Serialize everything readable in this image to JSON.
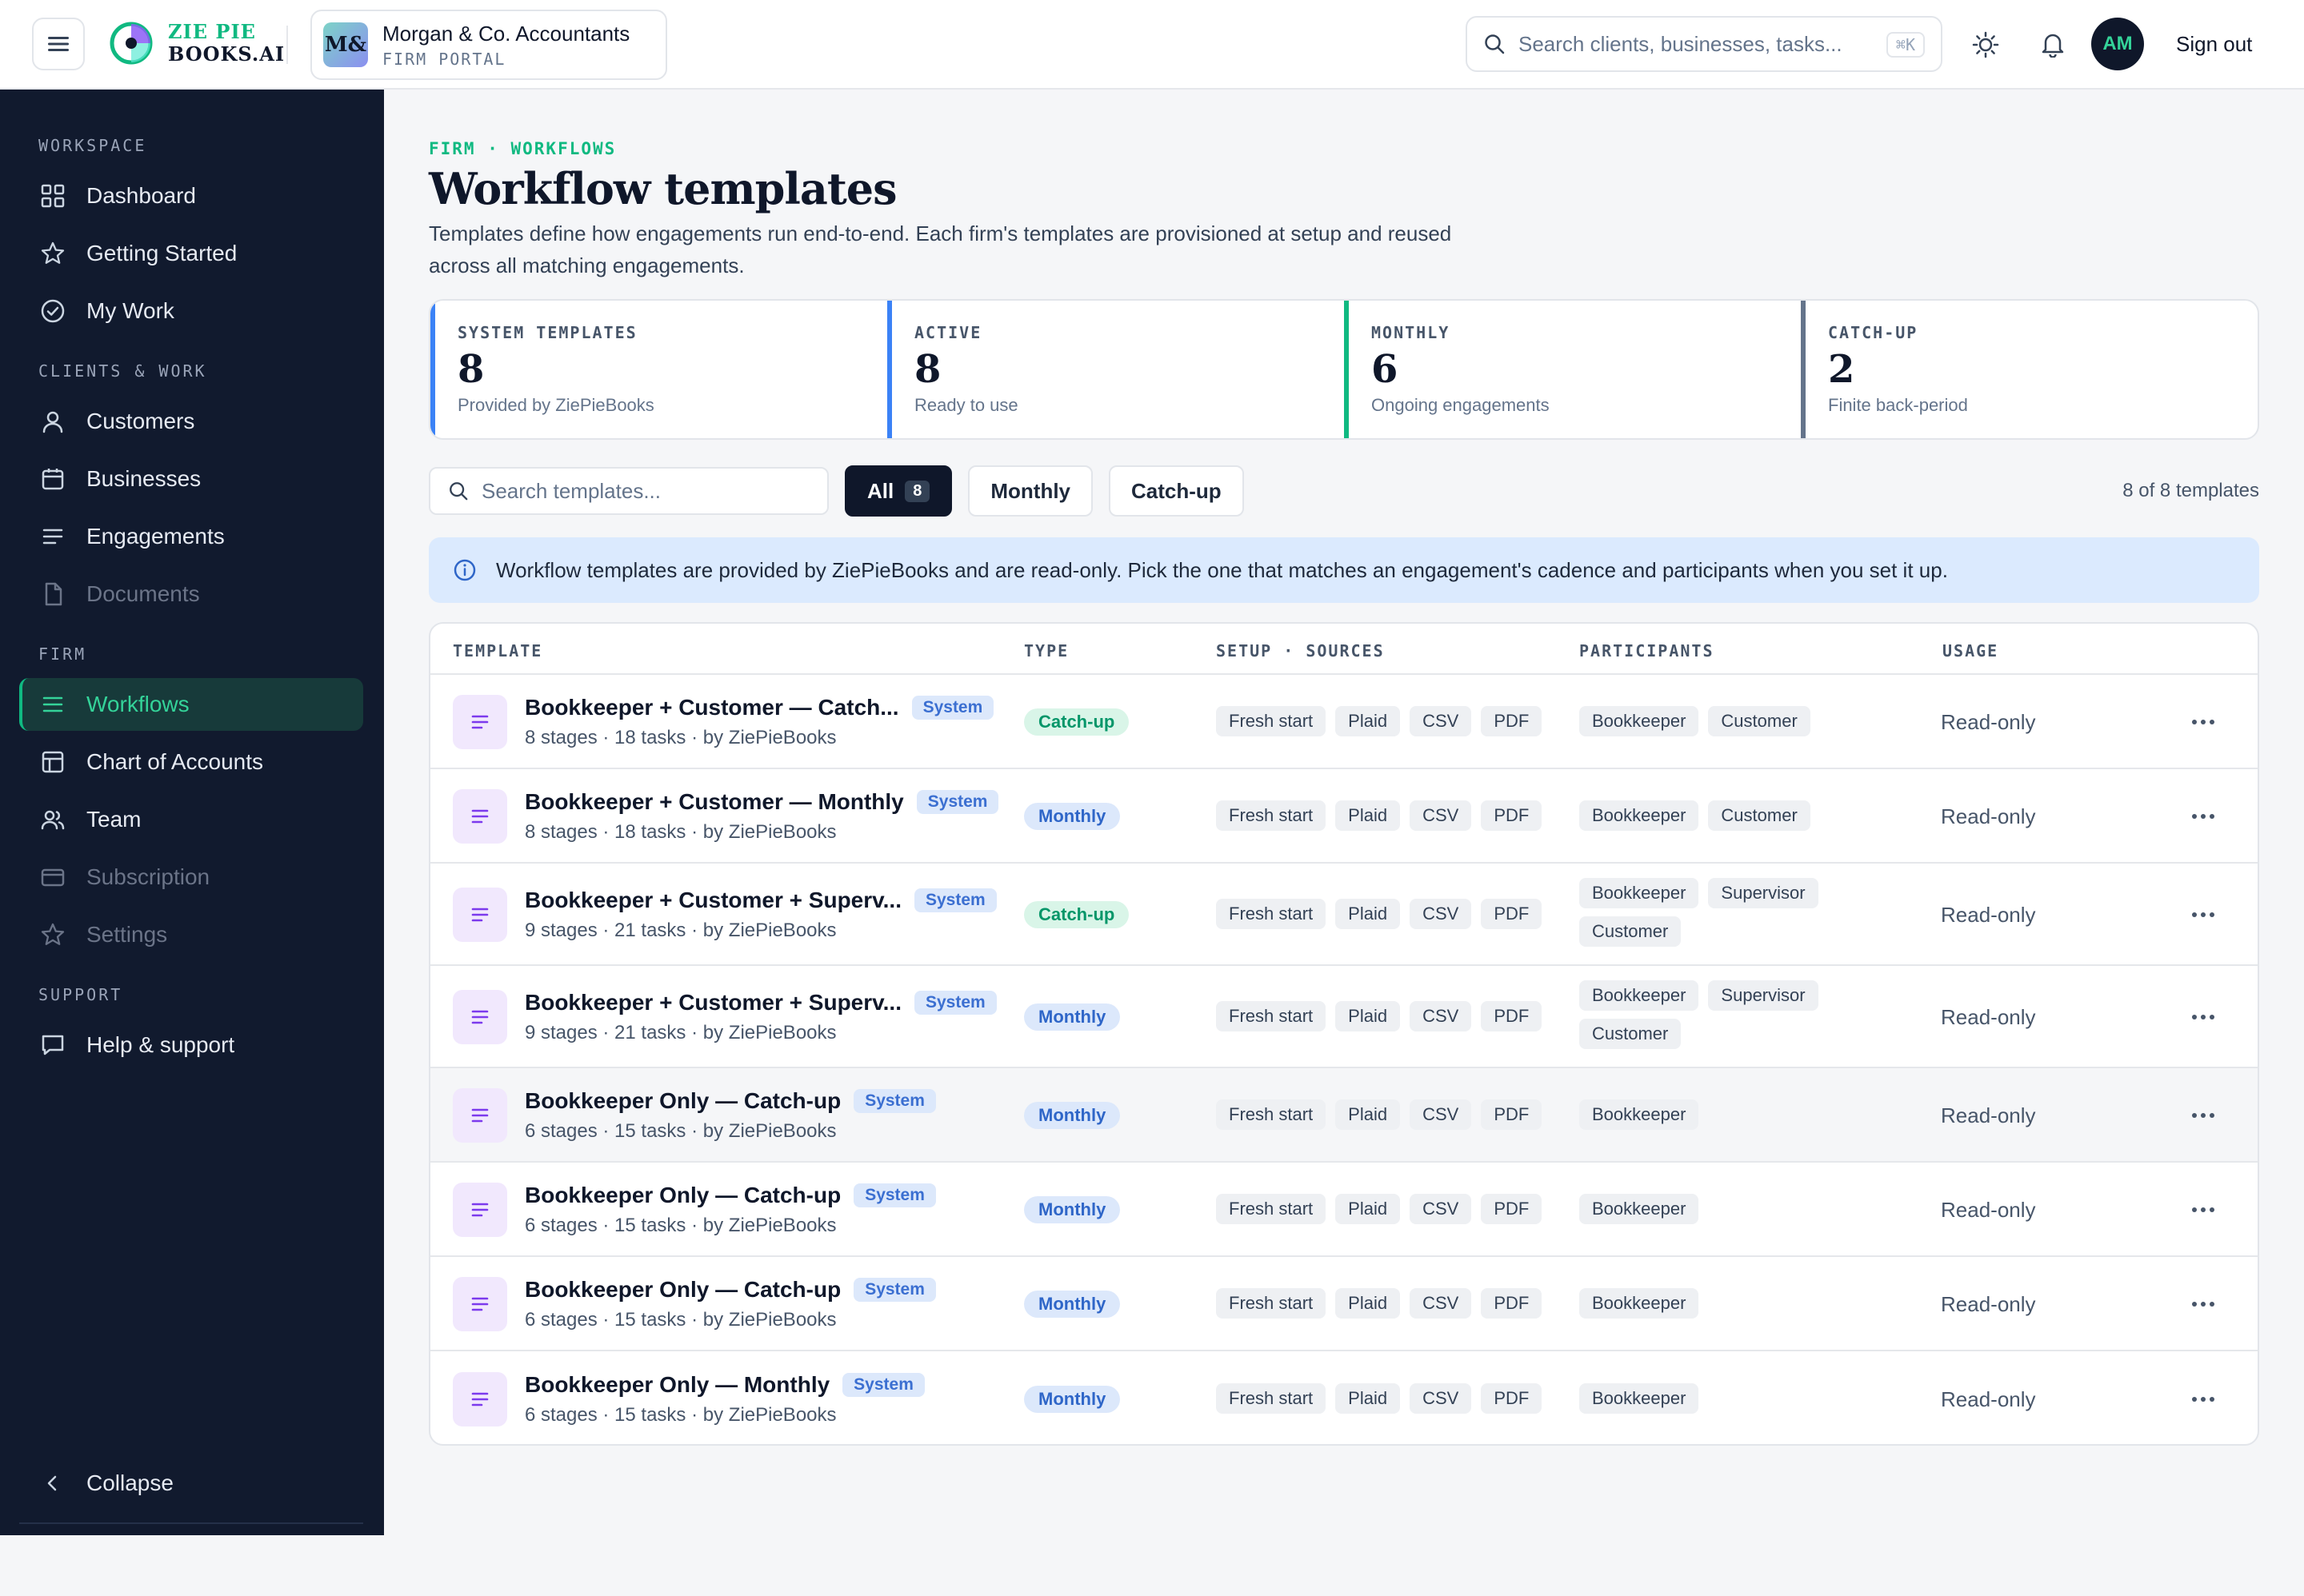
{
  "header": {
    "logo_line1": "ZIE PIE",
    "logo_line2": "BOOKS.AI",
    "firm_initials": "M&",
    "firm_name": "Morgan & Co. Accountants",
    "firm_sub": "FIRM PORTAL",
    "search_placeholder": "Search clients, businesses, tasks...",
    "search_shortcut": "⌘K",
    "user_initials": "AM",
    "sign_out": "Sign out"
  },
  "sidebar": {
    "groups": {
      "workspace": "WORKSPACE",
      "clients": "CLIENTS & WORK",
      "firm": "FIRM",
      "support": "SUPPORT"
    },
    "items": [
      {
        "label": "Dashboard",
        "icon": "grid-icon"
      },
      {
        "label": "Getting Started",
        "icon": "star-icon"
      },
      {
        "label": "My Work",
        "icon": "check-circle-icon"
      },
      {
        "label": "Customers",
        "icon": "user-icon"
      },
      {
        "label": "Businesses",
        "icon": "calendar-icon"
      },
      {
        "label": "Engagements",
        "icon": "lines-icon"
      },
      {
        "label": "Documents",
        "icon": "file-icon"
      },
      {
        "label": "Workflows",
        "icon": "lines-icon"
      },
      {
        "label": "Chart of Accounts",
        "icon": "layout-icon"
      },
      {
        "label": "Team",
        "icon": "users-icon"
      },
      {
        "label": "Subscription",
        "icon": "card-icon"
      },
      {
        "label": "Settings",
        "icon": "star-icon"
      },
      {
        "label": "Help & support",
        "icon": "chat-icon"
      }
    ],
    "collapse": "Collapse"
  },
  "page": {
    "breadcrumb": "FIRM · WORKFLOWS",
    "title": "Workflow templates",
    "description": "Templates define how engagements run end-to-end. Each firm's templates are provisioned at setup and reused across all matching engagements."
  },
  "stats": [
    {
      "label": "SYSTEM TEMPLATES",
      "value": "8",
      "sub": "Provided by ZiePieBooks",
      "color": "#3b82f6"
    },
    {
      "label": "ACTIVE",
      "value": "8",
      "sub": "Ready to use",
      "color": "#3b82f6"
    },
    {
      "label": "MONTHLY",
      "value": "6",
      "sub": "Ongoing engagements",
      "color": "#10b981"
    },
    {
      "label": "CATCH-UP",
      "value": "2",
      "sub": "Finite back-period",
      "color": "#64748b"
    }
  ],
  "filters": {
    "search_placeholder": "Search templates...",
    "all_label": "All",
    "all_count": "8",
    "monthly_label": "Monthly",
    "catchup_label": "Catch-up",
    "result_count": "8 of 8 templates"
  },
  "info_text": "Workflow templates are provided by ZiePieBooks and are read-only. Pick the one that matches an engagement's cadence and participants when you set it up.",
  "table": {
    "headers": [
      "TEMPLATE",
      "TYPE",
      "SETUP · SOURCES",
      "PARTICIPANTS",
      "USAGE"
    ],
    "rows": [
      {
        "name": "Bookkeeper + Customer — Catch...",
        "badge": "System",
        "meta": "8 stages · 18 tasks · by ZiePieBooks",
        "type": "Catch-up",
        "sources": [
          "Fresh start",
          "Plaid",
          "CSV",
          "PDF"
        ],
        "participants": [
          "Bookkeeper",
          "Customer"
        ],
        "usage": "Read-only"
      },
      {
        "name": "Bookkeeper + Customer — Monthly",
        "badge": "System",
        "meta": "8 stages · 18 tasks · by ZiePieBooks",
        "type": "Monthly",
        "sources": [
          "Fresh start",
          "Plaid",
          "CSV",
          "PDF"
        ],
        "participants": [
          "Bookkeeper",
          "Customer"
        ],
        "usage": "Read-only"
      },
      {
        "name": "Bookkeeper + Customer + Superv...",
        "badge": "System",
        "meta": "9 stages · 21 tasks · by ZiePieBooks",
        "type": "Catch-up",
        "sources": [
          "Fresh start",
          "Plaid",
          "CSV",
          "PDF"
        ],
        "participants": [
          "Bookkeeper",
          "Supervisor",
          "Customer"
        ],
        "usage": "Read-only"
      },
      {
        "name": "Bookkeeper + Customer + Superv...",
        "badge": "System",
        "meta": "9 stages · 21 tasks · by ZiePieBooks",
        "type": "Monthly",
        "sources": [
          "Fresh start",
          "Plaid",
          "CSV",
          "PDF"
        ],
        "participants": [
          "Bookkeeper",
          "Supervisor",
          "Customer"
        ],
        "usage": "Read-only"
      },
      {
        "name": "Bookkeeper Only — Catch-up",
        "badge": "System",
        "meta": "6 stages · 15 tasks · by ZiePieBooks",
        "type": "Monthly",
        "sources": [
          "Fresh start",
          "Plaid",
          "CSV",
          "PDF"
        ],
        "participants": [
          "Bookkeeper"
        ],
        "usage": "Read-only"
      },
      {
        "name": "Bookkeeper Only — Catch-up",
        "badge": "System",
        "meta": "6 stages · 15 tasks · by ZiePieBooks",
        "type": "Monthly",
        "sources": [
          "Fresh start",
          "Plaid",
          "CSV",
          "PDF"
        ],
        "participants": [
          "Bookkeeper"
        ],
        "usage": "Read-only"
      },
      {
        "name": "Bookkeeper Only — Catch-up",
        "badge": "System",
        "meta": "6 stages · 15 tasks · by ZiePieBooks",
        "type": "Monthly",
        "sources": [
          "Fresh start",
          "Plaid",
          "CSV",
          "PDF"
        ],
        "participants": [
          "Bookkeeper"
        ],
        "usage": "Read-only"
      },
      {
        "name": "Bookkeeper Only — Monthly",
        "badge": "System",
        "meta": "6 stages · 15 tasks · by ZiePieBooks",
        "type": "Monthly",
        "sources": [
          "Fresh start",
          "Plaid",
          "CSV",
          "PDF"
        ],
        "participants": [
          "Bookkeeper"
        ],
        "usage": "Read-only"
      }
    ]
  }
}
